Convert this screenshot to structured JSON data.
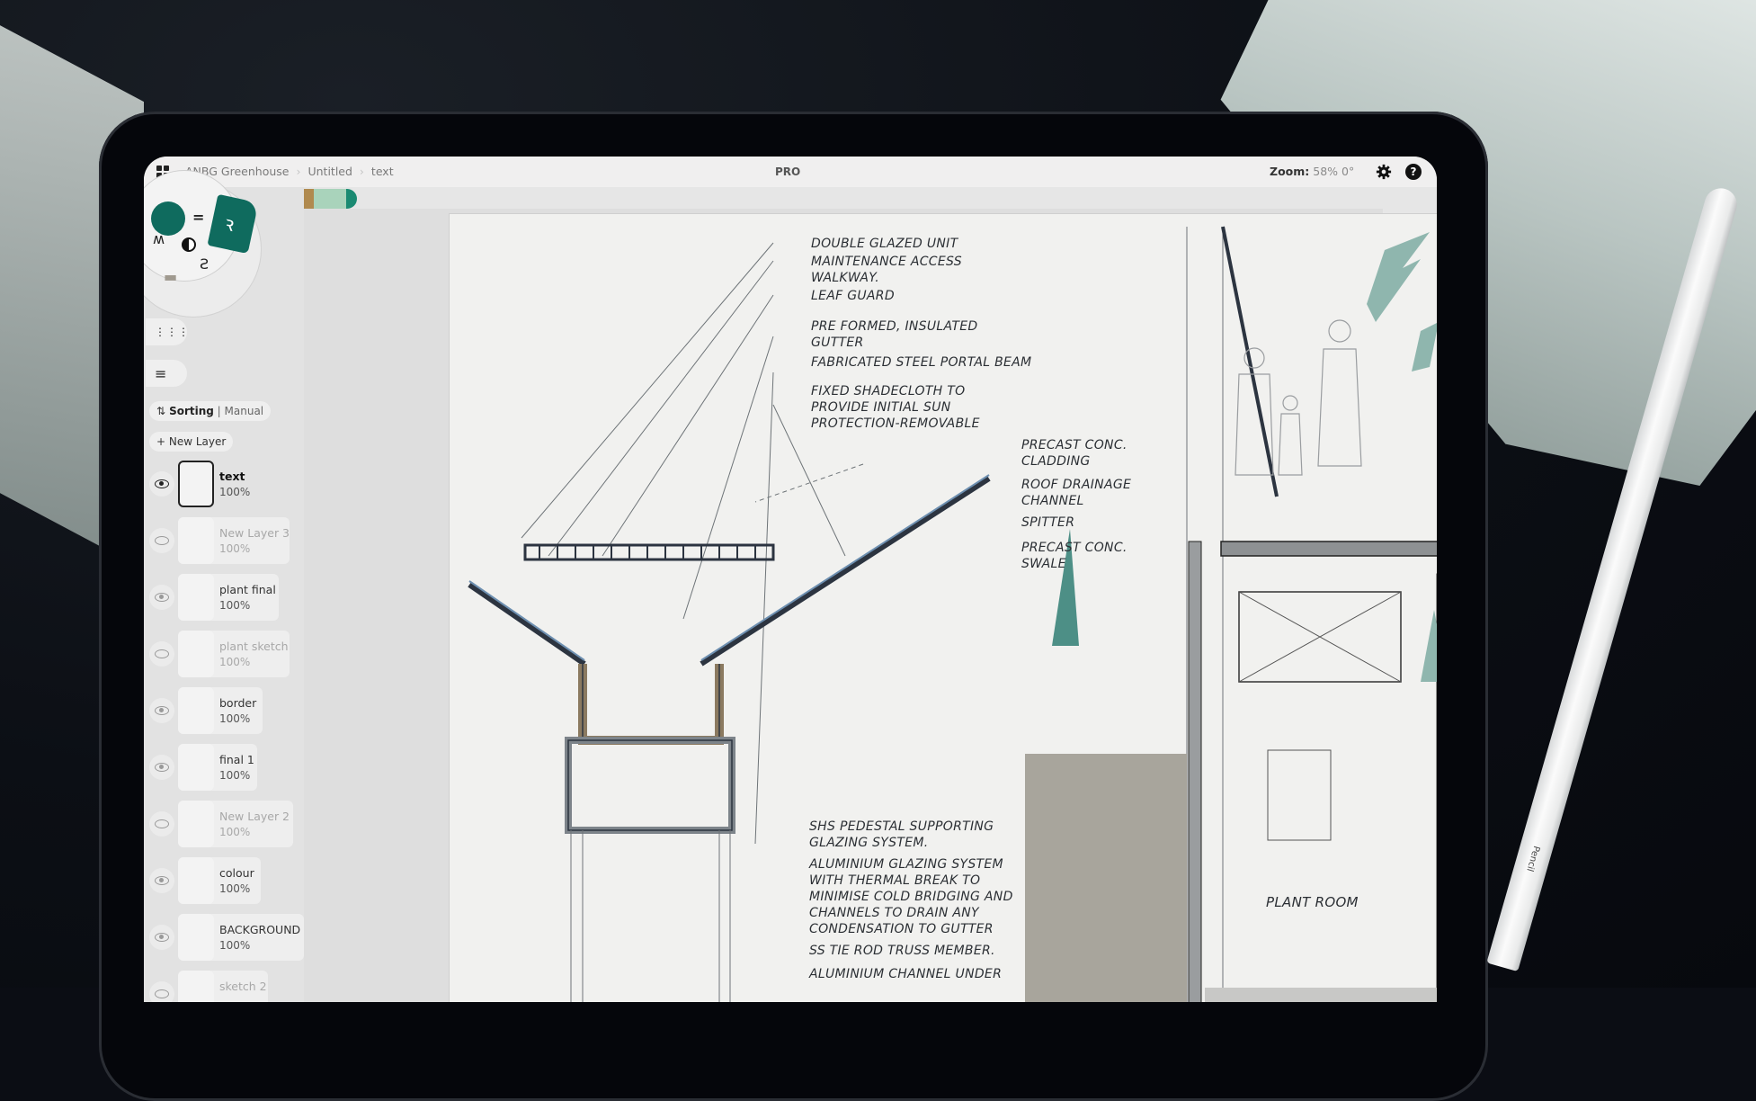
{
  "app": {
    "breadcrumb": [
      "ANBG Greenhouse",
      "Untitled",
      "text"
    ],
    "badge": "PRO",
    "zoom_label": "Zoom:",
    "zoom_value": "58%",
    "rotation_value": "0°",
    "icons": {
      "apps": "grid-icon",
      "settings": "gear-icon",
      "help": "help-icon",
      "export": "upload-icon",
      "import": "download-icon"
    }
  },
  "palette": {
    "swatches": [
      "#b08a4f",
      "#a9d3bb",
      "#1a8a72"
    ]
  },
  "tool_wheel": {
    "current_colour": "#0f6b5e",
    "active_brush_colour": "#0f6b5e"
  },
  "sidebar": {
    "sorting_label": "Sorting",
    "sorting_mode": "Manual",
    "new_layer_label": "+ New Layer",
    "layers": [
      {
        "name": "text",
        "opacity": "100%",
        "visible": true,
        "active": true
      },
      {
        "name": "New Layer 3",
        "opacity": "100%",
        "visible": false,
        "active": false
      },
      {
        "name": "plant final",
        "opacity": "100%",
        "visible": true,
        "active": false
      },
      {
        "name": "plant sketch",
        "opacity": "100%",
        "visible": false,
        "active": false
      },
      {
        "name": "border",
        "opacity": "100%",
        "visible": true,
        "active": false
      },
      {
        "name": "final 1",
        "opacity": "100%",
        "visible": true,
        "active": false
      },
      {
        "name": "New Layer 2",
        "opacity": "100%",
        "visible": false,
        "active": false
      },
      {
        "name": "colour",
        "opacity": "100%",
        "visible": true,
        "active": false
      },
      {
        "name": "BACKGROUND",
        "opacity": "100%",
        "visible": true,
        "active": false
      },
      {
        "name": "sketch 2",
        "opacity": "",
        "visible": false,
        "active": false
      }
    ]
  },
  "drawing": {
    "annotations_left": [
      "DOUBLE GLAZED UNIT",
      "MAINTENANCE ACCESS\nWALKWAY.",
      "LEAF GUARD",
      "PRE FORMED, INSULATED\nGUTTER",
      "FABRICATED STEEL PORTAL BEAM",
      "FIXED SHADECLOTH TO\nPROVIDE INITIAL SUN\nPROTECTION-REMOVABLE"
    ],
    "annotations_mid": [
      "PRECAST CONC.\nCLADDING",
      "ROOF DRAINAGE\nCHANNEL",
      "SPITTER",
      "PRECAST CONC.\nSWALE"
    ],
    "annotations_bottom": [
      "SHS PEDESTAL SUPPORTING\nGLAZING SYSTEM.",
      "ALUMINIUM GLAZING SYSTEM\nWITH THERMAL BREAK TO\nMINIMISE COLD BRIDGING AND\nCHANNELS TO DRAIN ANY\nCONDENSATION TO GUTTER",
      "SS TIE ROD TRUSS MEMBER.",
      "ALUMINIUM CHANNEL UNDER"
    ],
    "room_label": "PLANT ROOM"
  },
  "pencil_brand": "Pencil"
}
